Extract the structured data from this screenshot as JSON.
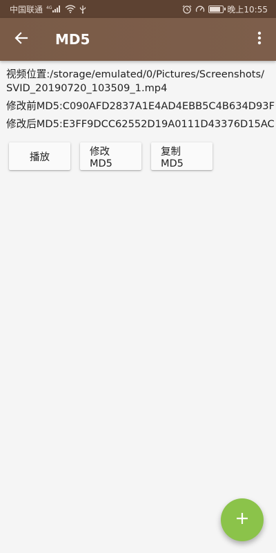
{
  "status_bar": {
    "carrier": "中国联通",
    "network": "4G",
    "time": "晚上10:55",
    "icons": [
      "signal-icon",
      "wifi-icon",
      "usb-icon",
      "alarm-icon",
      "speed-icon",
      "battery-icon"
    ],
    "battery_level": 0.85
  },
  "app_bar": {
    "title": "MD5",
    "back_icon": "arrow-back-icon",
    "menu_icon": "more-vert-icon",
    "color": "#7a5b47"
  },
  "info": {
    "path_line1": "视频位置:/storage/emulated/0/Pictures/Screenshots/",
    "path_line2": "SVID_20190720_103509_1.mp4",
    "md5_before": "修改前MD5:C090AFD2837A1E4AD4EBB5C4B634D93F",
    "md5_after": "修改后MD5:E3FF9DCC62552D19A0111D43376D15AC"
  },
  "buttons": {
    "play": "播放",
    "modify": "修改MD5",
    "copy": "复制MD5"
  },
  "fab": {
    "icon": "add-icon",
    "color": "#8bc34a"
  }
}
